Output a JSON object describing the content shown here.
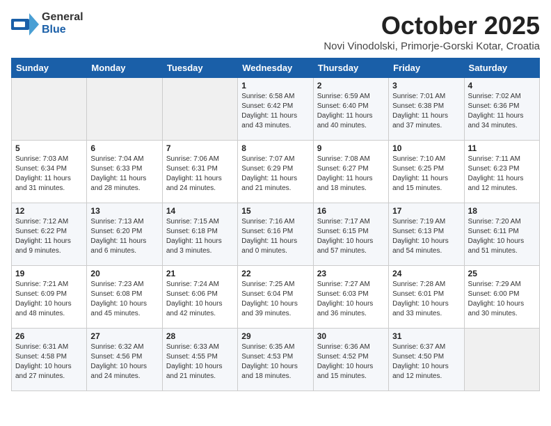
{
  "header": {
    "logo_general": "General",
    "logo_blue": "Blue",
    "month_title": "October 2025",
    "location": "Novi Vinodolski, Primorje-Gorski Kotar, Croatia"
  },
  "weekdays": [
    "Sunday",
    "Monday",
    "Tuesday",
    "Wednesday",
    "Thursday",
    "Friday",
    "Saturday"
  ],
  "weeks": [
    [
      {
        "day": "",
        "info": ""
      },
      {
        "day": "",
        "info": ""
      },
      {
        "day": "",
        "info": ""
      },
      {
        "day": "1",
        "info": "Sunrise: 6:58 AM\nSunset: 6:42 PM\nDaylight: 11 hours\nand 43 minutes."
      },
      {
        "day": "2",
        "info": "Sunrise: 6:59 AM\nSunset: 6:40 PM\nDaylight: 11 hours\nand 40 minutes."
      },
      {
        "day": "3",
        "info": "Sunrise: 7:01 AM\nSunset: 6:38 PM\nDaylight: 11 hours\nand 37 minutes."
      },
      {
        "day": "4",
        "info": "Sunrise: 7:02 AM\nSunset: 6:36 PM\nDaylight: 11 hours\nand 34 minutes."
      }
    ],
    [
      {
        "day": "5",
        "info": "Sunrise: 7:03 AM\nSunset: 6:34 PM\nDaylight: 11 hours\nand 31 minutes."
      },
      {
        "day": "6",
        "info": "Sunrise: 7:04 AM\nSunset: 6:33 PM\nDaylight: 11 hours\nand 28 minutes."
      },
      {
        "day": "7",
        "info": "Sunrise: 7:06 AM\nSunset: 6:31 PM\nDaylight: 11 hours\nand 24 minutes."
      },
      {
        "day": "8",
        "info": "Sunrise: 7:07 AM\nSunset: 6:29 PM\nDaylight: 11 hours\nand 21 minutes."
      },
      {
        "day": "9",
        "info": "Sunrise: 7:08 AM\nSunset: 6:27 PM\nDaylight: 11 hours\nand 18 minutes."
      },
      {
        "day": "10",
        "info": "Sunrise: 7:10 AM\nSunset: 6:25 PM\nDaylight: 11 hours\nand 15 minutes."
      },
      {
        "day": "11",
        "info": "Sunrise: 7:11 AM\nSunset: 6:23 PM\nDaylight: 11 hours\nand 12 minutes."
      }
    ],
    [
      {
        "day": "12",
        "info": "Sunrise: 7:12 AM\nSunset: 6:22 PM\nDaylight: 11 hours\nand 9 minutes."
      },
      {
        "day": "13",
        "info": "Sunrise: 7:13 AM\nSunset: 6:20 PM\nDaylight: 11 hours\nand 6 minutes."
      },
      {
        "day": "14",
        "info": "Sunrise: 7:15 AM\nSunset: 6:18 PM\nDaylight: 11 hours\nand 3 minutes."
      },
      {
        "day": "15",
        "info": "Sunrise: 7:16 AM\nSunset: 6:16 PM\nDaylight: 11 hours\nand 0 minutes."
      },
      {
        "day": "16",
        "info": "Sunrise: 7:17 AM\nSunset: 6:15 PM\nDaylight: 10 hours\nand 57 minutes."
      },
      {
        "day": "17",
        "info": "Sunrise: 7:19 AM\nSunset: 6:13 PM\nDaylight: 10 hours\nand 54 minutes."
      },
      {
        "day": "18",
        "info": "Sunrise: 7:20 AM\nSunset: 6:11 PM\nDaylight: 10 hours\nand 51 minutes."
      }
    ],
    [
      {
        "day": "19",
        "info": "Sunrise: 7:21 AM\nSunset: 6:09 PM\nDaylight: 10 hours\nand 48 minutes."
      },
      {
        "day": "20",
        "info": "Sunrise: 7:23 AM\nSunset: 6:08 PM\nDaylight: 10 hours\nand 45 minutes."
      },
      {
        "day": "21",
        "info": "Sunrise: 7:24 AM\nSunset: 6:06 PM\nDaylight: 10 hours\nand 42 minutes."
      },
      {
        "day": "22",
        "info": "Sunrise: 7:25 AM\nSunset: 6:04 PM\nDaylight: 10 hours\nand 39 minutes."
      },
      {
        "day": "23",
        "info": "Sunrise: 7:27 AM\nSunset: 6:03 PM\nDaylight: 10 hours\nand 36 minutes."
      },
      {
        "day": "24",
        "info": "Sunrise: 7:28 AM\nSunset: 6:01 PM\nDaylight: 10 hours\nand 33 minutes."
      },
      {
        "day": "25",
        "info": "Sunrise: 7:29 AM\nSunset: 6:00 PM\nDaylight: 10 hours\nand 30 minutes."
      }
    ],
    [
      {
        "day": "26",
        "info": "Sunrise: 6:31 AM\nSunset: 4:58 PM\nDaylight: 10 hours\nand 27 minutes."
      },
      {
        "day": "27",
        "info": "Sunrise: 6:32 AM\nSunset: 4:56 PM\nDaylight: 10 hours\nand 24 minutes."
      },
      {
        "day": "28",
        "info": "Sunrise: 6:33 AM\nSunset: 4:55 PM\nDaylight: 10 hours\nand 21 minutes."
      },
      {
        "day": "29",
        "info": "Sunrise: 6:35 AM\nSunset: 4:53 PM\nDaylight: 10 hours\nand 18 minutes."
      },
      {
        "day": "30",
        "info": "Sunrise: 6:36 AM\nSunset: 4:52 PM\nDaylight: 10 hours\nand 15 minutes."
      },
      {
        "day": "31",
        "info": "Sunrise: 6:37 AM\nSunset: 4:50 PM\nDaylight: 10 hours\nand 12 minutes."
      },
      {
        "day": "",
        "info": ""
      }
    ]
  ]
}
